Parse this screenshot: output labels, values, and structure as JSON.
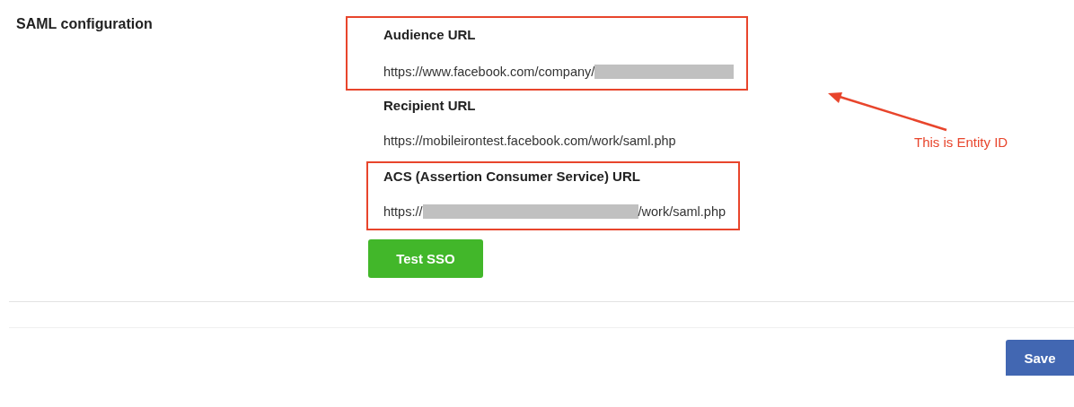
{
  "section_title": "SAML configuration",
  "fields": [
    {
      "label": "Audience URL",
      "highlighted": true,
      "value_parts": [
        {
          "kind": "text",
          "text": "https://www.facebook.com/company/"
        },
        {
          "kind": "redacted"
        }
      ]
    },
    {
      "label": "Recipient URL",
      "highlighted": false,
      "value_parts": [
        {
          "kind": "text",
          "text": "https://mobileirontest.facebook.com/work/saml.php"
        }
      ]
    },
    {
      "label": "ACS (Assertion Consumer Service) URL",
      "highlighted": true,
      "value_parts": [
        {
          "kind": "text",
          "text": "https://"
        },
        {
          "kind": "redacted"
        },
        {
          "kind": "text",
          "text": "/work/saml.php"
        }
      ]
    }
  ],
  "test_button": "Test SSO",
  "annotation": "This is Entity ID",
  "save_button": "Save"
}
